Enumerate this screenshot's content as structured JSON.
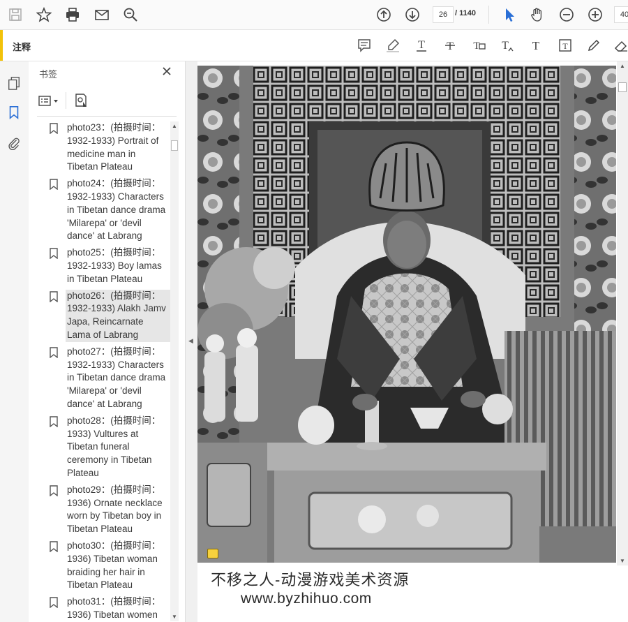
{
  "toolbar": {
    "page_current": "26",
    "page_total": "/ 1140",
    "zoom": "40"
  },
  "annotation_bar": {
    "title": "注释"
  },
  "bookmarks_panel": {
    "title": "书签",
    "items": [
      {
        "text": "photo23：(拍摄时间：1932-1933) Portrait of medicine man in Tibetan Plateau",
        "selected": false
      },
      {
        "text": "photo24：(拍摄时间：1932-1933) Characters in Tibetan dance drama 'Milarepa' or 'devil dance' at Labrang",
        "selected": false
      },
      {
        "text": "photo25：(拍摄时间：1932-1933) Boy lamas in Tibetan Plateau",
        "selected": false
      },
      {
        "text": "photo26：(拍摄时间：1932-1933) Alakh Jamv Japa, Reincarnate Lama of Labrang",
        "selected": true
      },
      {
        "text": "photo27：(拍摄时间：1932-1933) Characters in Tibetan dance drama 'Milarepa' or 'devil dance' at Labrang",
        "selected": false
      },
      {
        "text": "photo28：(拍摄时间：1933) Vultures at Tibetan funeral ceremony in Tibetan Plateau",
        "selected": false
      },
      {
        "text": "photo29：(拍摄时间：1936) Ornate necklace worn by Tibetan boy in Tibetan Plateau",
        "selected": false
      },
      {
        "text": "photo30：(拍摄时间：1936) Tibetan woman braiding her hair in Tibetan Plateau",
        "selected": false
      },
      {
        "text": "photo31：(拍摄时间：1936) Tibetan women",
        "selected": false
      }
    ]
  },
  "watermark": {
    "line1": "不移之人-动漫游戏美术资源",
    "line2": "www.byzhihuo.com"
  },
  "colors": {
    "accent_yellow": "#f2c20a",
    "link_blue": "#2a6fd6",
    "selected_bg": "#e6e6e6"
  }
}
